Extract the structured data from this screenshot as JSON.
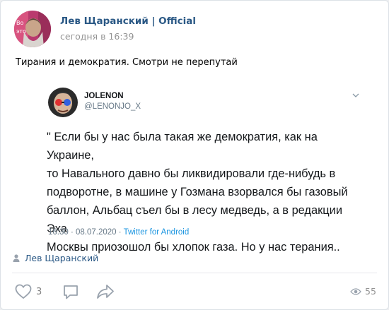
{
  "post": {
    "author": "Лев Щаранский | Official",
    "date": "сегодня в 16:39",
    "text": "Тирания и демократия. Смотри не перепутай"
  },
  "tweet": {
    "name": "JOLENON",
    "handle": "@LENONJO_X",
    "text": "\" Если бы у нас была такая же демократия, как на Украине,\nто Навального давно бы ликвидировали где-нибудь в\nподворотне, в машине у Гозмана взорвался бы газовый\nбаллон, Альбац съел бы в лесу медведь, а в редакции Эха\nМосквы приозошол бы хлопок газа. Но у нас терания..",
    "time": "16:30 · 08.07.2020 · ",
    "source": "Twitter for Android"
  },
  "signer": {
    "icon": "person-icon",
    "name": "Лев Щаранский"
  },
  "actions": {
    "like_icon": "heart-icon",
    "likes": "3",
    "comment_icon": "comment-icon",
    "share_icon": "share-icon",
    "views_icon": "eye-icon",
    "views": "55"
  },
  "colors": {
    "link": "#2a5885",
    "muted": "#939393",
    "twitter_blue": "#1b95e0",
    "icon_gray": "#99a2ad"
  }
}
